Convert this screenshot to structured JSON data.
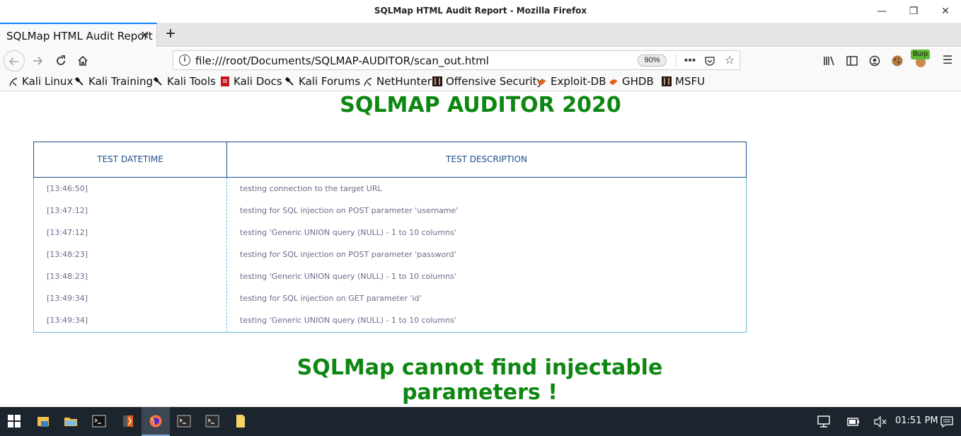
{
  "window": {
    "title": "SQLMap HTML Audit Report - Mozilla Firefox",
    "controls": {
      "minimize": "—",
      "restore": "❐",
      "close": "✕"
    }
  },
  "tabs": [
    {
      "label": "SQLMap HTML Audit Report",
      "close": "✕"
    }
  ],
  "new_tab_label": "+",
  "navbar": {
    "url": "file:///root/Documents/SQLMAP-AUDITOR/scan_out.html",
    "zoom": "90%",
    "burp_badge": "Burp"
  },
  "bookmarks": [
    {
      "label": "Kali Linux",
      "icon": "kali-dragon-icon"
    },
    {
      "label": "Kali Training",
      "icon": "kali-tool-icon"
    },
    {
      "label": "Kali Tools",
      "icon": "kali-tool-icon"
    },
    {
      "label": "Kali Docs",
      "icon": "docs-icon"
    },
    {
      "label": "Kali Forums",
      "icon": "kali-tool-icon"
    },
    {
      "label": "NetHunter",
      "icon": "kali-dragon-icon"
    },
    {
      "label": "Offensive Security",
      "icon": "offsec-icon"
    },
    {
      "label": "Exploit-DB",
      "icon": "exploitdb-icon"
    },
    {
      "label": "GHDB",
      "icon": "exploitdb-icon"
    },
    {
      "label": "MSFU",
      "icon": "offsec-icon"
    }
  ],
  "page": {
    "heading": "SQLMAP AUDITOR 2020",
    "table": {
      "headers": {
        "datetime": "TEST DATETIME",
        "description": "TEST DESCRIPTION"
      },
      "rows": [
        {
          "time": "[13:46:50]",
          "desc": "testing connection to the target URL"
        },
        {
          "time": "[13:47:12]",
          "desc": "testing for SQL injection on POST parameter 'username'"
        },
        {
          "time": "[13:47:12]",
          "desc": "testing 'Generic UNION query (NULL) - 1 to 10 columns'"
        },
        {
          "time": "[13:48:23]",
          "desc": "testing for SQL injection on POST parameter 'password'"
        },
        {
          "time": "[13:48:23]",
          "desc": "testing 'Generic UNION query (NULL) - 1 to 10 columns'"
        },
        {
          "time": "[13:49:34]",
          "desc": "testing for SQL injection on GET parameter 'id'"
        },
        {
          "time": "[13:49:34]",
          "desc": "testing 'Generic UNION query (NULL) - 1 to 10 columns'"
        }
      ]
    },
    "result": "SQLMap cannot find injectable parameters !"
  },
  "taskbar": {
    "clock": "01:51 PM",
    "colors": {
      "background": "#1c252d",
      "accent_green": "#0e8712",
      "header_blue": "#1d4f8e"
    }
  }
}
